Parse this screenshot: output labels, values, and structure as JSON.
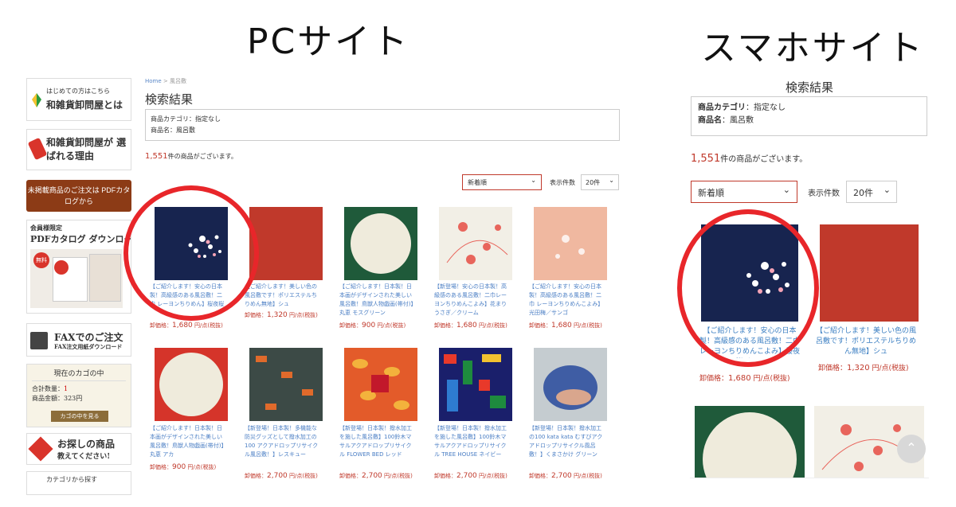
{
  "headings": {
    "pc": "PCサイト",
    "sp": "スマホサイト"
  },
  "sidebar": {
    "beginner_small": "はじめての方はこちら",
    "beginner_large": "和雑貨卸問屋とは",
    "reason": "和雑貨卸問屋が 選ばれる理由",
    "order_banner": "未掲載商品のご注文は PDFカタログから",
    "catalog_small": "会員様限定",
    "catalog_large": "PDFカタログ ダウンロード",
    "catalog_badge": "無料",
    "fax_large": "FAXでのご注文",
    "fax_small": "FAX注文用紙ダウンロード",
    "cart_head": "現在のカゴの中",
    "cart_qty_label": "合計数量：",
    "cart_qty": "1",
    "cart_amount_label": "商品金額：",
    "cart_amount": "323円",
    "cart_btn": "カゴの中を見る",
    "search_large": "お探しの商品",
    "search_small": "教えてください!",
    "category": "カテゴリから探す"
  },
  "pc": {
    "breadcrumb_home": "Home",
    "breadcrumb_sep": " > ",
    "breadcrumb_cur": "風呂敷",
    "title": "検索結果",
    "cond1": "商品カテゴリ：指定なし",
    "cond2": "商品名：風呂敷",
    "count": "1,551",
    "count_suffix": "件の商品がございます。",
    "sort": "新着順",
    "chev": "⌄",
    "per_label": "表示件数",
    "per": "20件",
    "products": [
      {
        "text": "【ご紹介します！安心の日本製！高級感のある風呂敷！二巾 レーヨンちりめん】桜夜桜",
        "price": "1,680",
        "price_pre": "卸価格：",
        "price_suf": " 円/点(税抜)"
      },
      {
        "text": "【ご紹介します！美しい色の風呂敷です！ポリエステルちりめん無地】シュ",
        "price": "1,320",
        "price_pre": "卸価格：",
        "price_suf": " 円/点(税抜)"
      },
      {
        "text": "【ご紹介します！日本製！日本画がデザインされた美しい風呂敷！鳥獣人物戯画(帯付)】丸恵 モスグリーン",
        "price": "900",
        "price_pre": "卸価格：",
        "price_suf": " 円/点(税抜)"
      },
      {
        "text": "【新登場！安心の日本製！高級感のある風呂敷！二巾レーヨンちりめんこよみ】花まりうさぎ／クリーム",
        "price": "1,680",
        "price_pre": "卸価格：",
        "price_suf": " 円/点(税抜)"
      },
      {
        "text": "【ご紹介します！安心の日本製！高級感のある風呂敷！二巾 レーヨンちりめんこよみ】光田梅／サンゴ",
        "price": "1,680",
        "price_pre": "卸価格：",
        "price_suf": " 円/点(税抜)"
      },
      {
        "text": "【ご紹介します！日本製！日本画がデザインされた美しい風呂敷！鳥獣人物戯画(帯付)】丸恵 アカ",
        "price": "900",
        "price_pre": "卸価格：",
        "price_suf": " 円/点(税抜)"
      },
      {
        "text": "【新登場！日本製！多機能な防災グッズとして撥水加工の100 アクアドロップリサイクル風呂敷！】レスキュー",
        "price": "2,700",
        "price_pre": "卸価格：",
        "price_suf": " 円/点(税抜)"
      },
      {
        "text": "【新登場！日本製！撥水加工を施した風呂敷】100鈴木マサルアクアドロップリサイクル FLOWER BED レッド",
        "price": "2,700",
        "price_pre": "卸価格：",
        "price_suf": " 円/点(税抜)"
      },
      {
        "text": "【新登場！日本製！撥水加工を施した風呂敷】100鈴木マサルアクアドロップリサイクル TREE HOUSE ネイビー",
        "price": "2,700",
        "price_pre": "卸価格：",
        "price_suf": " 円/点(税抜)"
      },
      {
        "text": "【新登場！日本製！撥水加工の100 kata kata むすびアクアドロップリサイクル風呂敷！】くまさかけ グリーン",
        "price": "2,700",
        "price_pre": "卸価格：",
        "price_suf": " 円/点(税抜)"
      }
    ]
  },
  "sp": {
    "title": "検索結果",
    "cond1_label": "商品カテゴリ",
    "cond1_value": "：指定なし",
    "cond2_label": "商品名",
    "cond2_value": "：風呂敷",
    "count": "1,551",
    "count_suffix": "件の商品がございます。",
    "sort": "新着順",
    "chev": "⌄",
    "per_label": "表示件数",
    "per": "20件",
    "products": [
      {
        "text": "【ご紹介します！安心の日本製！高級感のある風呂敷！二巾 レーヨンちりめんこよみ】桜夜桜／コン",
        "price": "1,680",
        "price_pre": "卸価格：",
        "price_suf": " 円/点(税抜)"
      },
      {
        "text": "【ご紹介します！美しい色の風呂敷です！ポリエステルちりめん無地】シュ",
        "price": "1,320",
        "price_pre": "卸価格：",
        "price_suf": " 円/点(税抜)"
      }
    ],
    "top_button": "⌃"
  },
  "colors": {
    "accent_red": "#c0392b",
    "highlight_circle": "#e8262a",
    "link_blue": "#4a7ec4"
  }
}
